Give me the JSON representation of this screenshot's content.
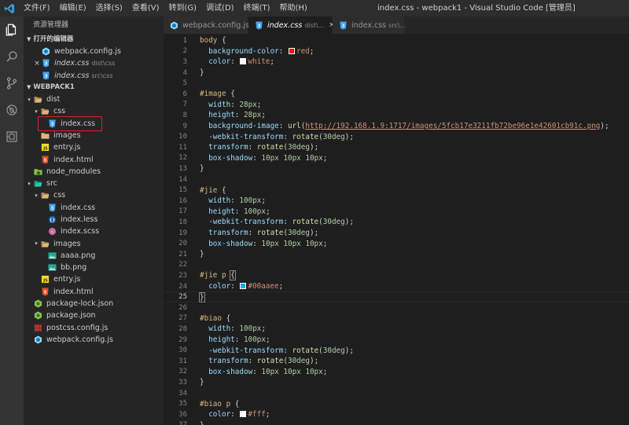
{
  "titlebar": {
    "menu": [
      "文件(F)",
      "编辑(E)",
      "选择(S)",
      "查看(V)",
      "转到(G)",
      "调试(D)",
      "终端(T)",
      "帮助(H)"
    ],
    "window_title": "index.css - webpack1 - Visual Studio Code [管理员]"
  },
  "colors": {
    "accent": "#007acc",
    "selection_box": "#e02020",
    "css_icon": "#42a5f5",
    "js_icon": "#f5de19",
    "html_icon": "#e44d26"
  },
  "activity": [
    "files-icon",
    "search-icon",
    "source-control-icon",
    "debug-icon",
    "extensions-icon"
  ],
  "sidebar": {
    "title": "资源管理器",
    "open_editors_header": "打开的编辑器",
    "open_editors": [
      {
        "name": "webpack.config.js",
        "desc": "",
        "icon": "webpack",
        "close": ""
      },
      {
        "name": "index.css",
        "desc": "dist\\css",
        "icon": "css",
        "close": "×"
      },
      {
        "name": "index.css",
        "desc": "src\\css",
        "icon": "css",
        "close": ""
      }
    ],
    "project_header": "WEBPACK1",
    "tree": [
      {
        "name": "dist",
        "depth": 0,
        "icon": "folder-open",
        "twisty": "▾"
      },
      {
        "name": "css",
        "depth": 1,
        "icon": "folder-open",
        "twisty": "▾"
      },
      {
        "name": "index.css",
        "depth": 2,
        "icon": "css",
        "twisty": ""
      },
      {
        "name": "images",
        "depth": 1,
        "icon": "folder",
        "twisty": ""
      },
      {
        "name": "entry.js",
        "depth": 1,
        "icon": "js",
        "twisty": ""
      },
      {
        "name": "index.html",
        "depth": 1,
        "icon": "html",
        "twisty": ""
      },
      {
        "name": "node_modules",
        "depth": 0,
        "icon": "node-folder",
        "twisty": ""
      },
      {
        "name": "src",
        "depth": 0,
        "icon": "src-folder",
        "twisty": "▾"
      },
      {
        "name": "css",
        "depth": 1,
        "icon": "folder-open",
        "twisty": "▾"
      },
      {
        "name": "index.css",
        "depth": 2,
        "icon": "css",
        "twisty": ""
      },
      {
        "name": "index.less",
        "depth": 2,
        "icon": "less",
        "twisty": ""
      },
      {
        "name": "index.scss",
        "depth": 2,
        "icon": "scss",
        "twisty": ""
      },
      {
        "name": "images",
        "depth": 1,
        "icon": "folder-open",
        "twisty": "▾"
      },
      {
        "name": "aaaa.png",
        "depth": 2,
        "icon": "image",
        "twisty": ""
      },
      {
        "name": "bb.png",
        "depth": 2,
        "icon": "image",
        "twisty": ""
      },
      {
        "name": "entry.js",
        "depth": 1,
        "icon": "js",
        "twisty": ""
      },
      {
        "name": "index.html",
        "depth": 1,
        "icon": "html",
        "twisty": ""
      },
      {
        "name": "package-lock.json",
        "depth": 0,
        "icon": "node",
        "twisty": ""
      },
      {
        "name": "package.json",
        "depth": 0,
        "icon": "node",
        "twisty": ""
      },
      {
        "name": "postcss.config.js",
        "depth": 0,
        "icon": "postcss",
        "twisty": ""
      },
      {
        "name": "webpack.config.js",
        "depth": 0,
        "icon": "webpack",
        "twisty": ""
      }
    ]
  },
  "tabs": [
    {
      "name": "webpack.config.js",
      "desc": "",
      "icon": "webpack",
      "active": false,
      "close": ""
    },
    {
      "name": "index.css",
      "desc": "dist\\...",
      "icon": "css",
      "active": true,
      "close": "×"
    },
    {
      "name": "index.css",
      "desc": "src\\...",
      "icon": "css",
      "active": false,
      "close": ""
    }
  ],
  "editor": {
    "current_line": 25,
    "lines": [
      [
        [
          "sel",
          "body"
        ],
        [
          "pun",
          " {"
        ]
      ],
      [
        [
          "pun",
          "  "
        ],
        [
          "prop",
          "background-color"
        ],
        [
          "pun",
          ": "
        ],
        [
          "swatch",
          "#ff0000"
        ],
        [
          "val",
          "red"
        ],
        [
          "pun",
          ";"
        ]
      ],
      [
        [
          "pun",
          "  "
        ],
        [
          "prop",
          "color"
        ],
        [
          "pun",
          ": "
        ],
        [
          "swatch",
          "#ffffff"
        ],
        [
          "val",
          "white"
        ],
        [
          "pun",
          ";"
        ]
      ],
      [
        [
          "pun",
          "}"
        ]
      ],
      [],
      [
        [
          "sel",
          "#image"
        ],
        [
          "pun",
          " {"
        ]
      ],
      [
        [
          "pun",
          "  "
        ],
        [
          "prop",
          "width"
        ],
        [
          "pun",
          ": "
        ],
        [
          "num",
          "28px"
        ],
        [
          "pun",
          ";"
        ]
      ],
      [
        [
          "pun",
          "  "
        ],
        [
          "prop",
          "height"
        ],
        [
          "pun",
          ": "
        ],
        [
          "num",
          "28px"
        ],
        [
          "pun",
          ";"
        ]
      ],
      [
        [
          "pun",
          "  "
        ],
        [
          "prop",
          "background-image"
        ],
        [
          "pun",
          ": "
        ],
        [
          "fn",
          "url"
        ],
        [
          "pun",
          "("
        ],
        [
          "url",
          "http://192.168.1.9:1717/images/5fcb17e3211fb72be96e1e42601cb91c.png"
        ],
        [
          "pun",
          ");"
        ]
      ],
      [
        [
          "pun",
          "  "
        ],
        [
          "prop",
          "-webkit-transform"
        ],
        [
          "pun",
          ": "
        ],
        [
          "fn",
          "rotate"
        ],
        [
          "pun",
          "("
        ],
        [
          "num",
          "30deg"
        ],
        [
          "pun",
          ");"
        ]
      ],
      [
        [
          "pun",
          "  "
        ],
        [
          "prop",
          "transform"
        ],
        [
          "pun",
          ": "
        ],
        [
          "fn",
          "rotate"
        ],
        [
          "pun",
          "("
        ],
        [
          "num",
          "30deg"
        ],
        [
          "pun",
          ");"
        ]
      ],
      [
        [
          "pun",
          "  "
        ],
        [
          "prop",
          "box-shadow"
        ],
        [
          "pun",
          ": "
        ],
        [
          "num",
          "10px 10px 10px"
        ],
        [
          "pun",
          ";"
        ]
      ],
      [
        [
          "pun",
          "}"
        ]
      ],
      [],
      [
        [
          "sel",
          "#jie"
        ],
        [
          "pun",
          " {"
        ]
      ],
      [
        [
          "pun",
          "  "
        ],
        [
          "prop",
          "width"
        ],
        [
          "pun",
          ": "
        ],
        [
          "num",
          "100px"
        ],
        [
          "pun",
          ";"
        ]
      ],
      [
        [
          "pun",
          "  "
        ],
        [
          "prop",
          "height"
        ],
        [
          "pun",
          ": "
        ],
        [
          "num",
          "100px"
        ],
        [
          "pun",
          ";"
        ]
      ],
      [
        [
          "pun",
          "  "
        ],
        [
          "prop",
          "-webkit-transform"
        ],
        [
          "pun",
          ": "
        ],
        [
          "fn",
          "rotate"
        ],
        [
          "pun",
          "("
        ],
        [
          "num",
          "30deg"
        ],
        [
          "pun",
          ");"
        ]
      ],
      [
        [
          "pun",
          "  "
        ],
        [
          "prop",
          "transform"
        ],
        [
          "pun",
          ": "
        ],
        [
          "fn",
          "rotate"
        ],
        [
          "pun",
          "("
        ],
        [
          "num",
          "30deg"
        ],
        [
          "pun",
          ");"
        ]
      ],
      [
        [
          "pun",
          "  "
        ],
        [
          "prop",
          "box-shadow"
        ],
        [
          "pun",
          ": "
        ],
        [
          "num",
          "10px 10px 10px"
        ],
        [
          "pun",
          ";"
        ]
      ],
      [
        [
          "pun",
          "}"
        ]
      ],
      [],
      [
        [
          "sel",
          "#jie p"
        ],
        [
          "pun",
          " "
        ],
        [
          "brace",
          "{"
        ]
      ],
      [
        [
          "pun",
          "  "
        ],
        [
          "prop",
          "color"
        ],
        [
          "pun",
          ": "
        ],
        [
          "swatch",
          "#00aaee"
        ],
        [
          "val",
          "#00aaee"
        ],
        [
          "pun",
          ";"
        ]
      ],
      [
        [
          "brace",
          "}"
        ]
      ],
      [],
      [
        [
          "sel",
          "#biao"
        ],
        [
          "pun",
          " {"
        ]
      ],
      [
        [
          "pun",
          "  "
        ],
        [
          "prop",
          "width"
        ],
        [
          "pun",
          ": "
        ],
        [
          "num",
          "100px"
        ],
        [
          "pun",
          ";"
        ]
      ],
      [
        [
          "pun",
          "  "
        ],
        [
          "prop",
          "height"
        ],
        [
          "pun",
          ": "
        ],
        [
          "num",
          "100px"
        ],
        [
          "pun",
          ";"
        ]
      ],
      [
        [
          "pun",
          "  "
        ],
        [
          "prop",
          "-webkit-transform"
        ],
        [
          "pun",
          ": "
        ],
        [
          "fn",
          "rotate"
        ],
        [
          "pun",
          "("
        ],
        [
          "num",
          "30deg"
        ],
        [
          "pun",
          ");"
        ]
      ],
      [
        [
          "pun",
          "  "
        ],
        [
          "prop",
          "transform"
        ],
        [
          "pun",
          ": "
        ],
        [
          "fn",
          "rotate"
        ],
        [
          "pun",
          "("
        ],
        [
          "num",
          "30deg"
        ],
        [
          "pun",
          ");"
        ]
      ],
      [
        [
          "pun",
          "  "
        ],
        [
          "prop",
          "box-shadow"
        ],
        [
          "pun",
          ": "
        ],
        [
          "num",
          "10px 10px 10px"
        ],
        [
          "pun",
          ";"
        ]
      ],
      [
        [
          "pun",
          "}"
        ]
      ],
      [],
      [
        [
          "sel",
          "#biao p"
        ],
        [
          "pun",
          " {"
        ]
      ],
      [
        [
          "pun",
          "  "
        ],
        [
          "prop",
          "color"
        ],
        [
          "pun",
          ": "
        ],
        [
          "swatch",
          "#ffffff"
        ],
        [
          "val",
          "#fff"
        ],
        [
          "pun",
          ";"
        ]
      ],
      [
        [
          "pun",
          "}"
        ]
      ]
    ]
  }
}
